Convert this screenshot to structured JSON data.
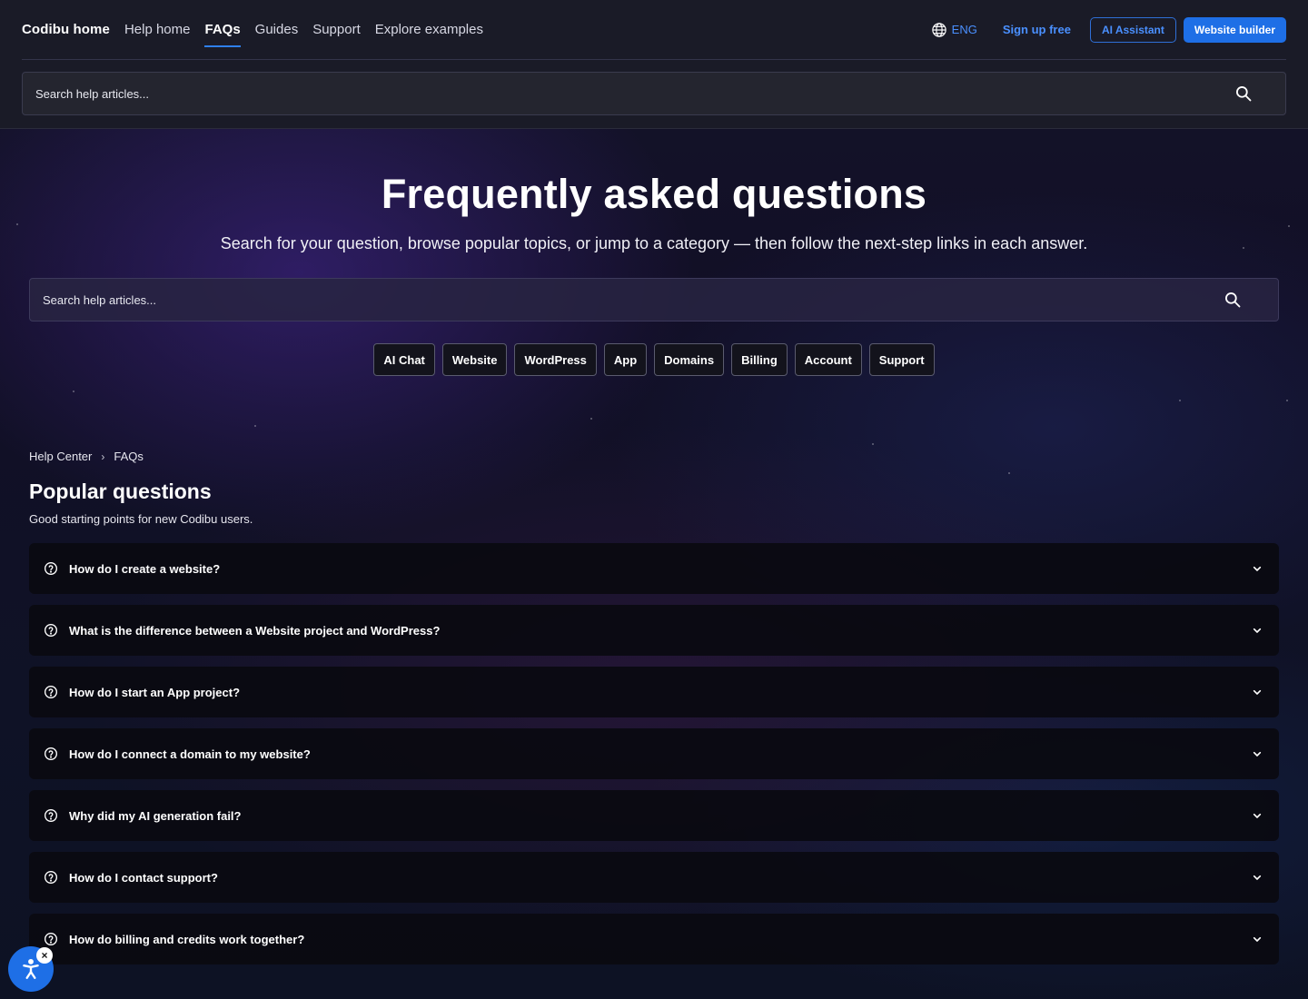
{
  "nav": {
    "brand": "Codibu home",
    "links": [
      "Help home",
      "FAQs",
      "Guides",
      "Support",
      "Explore examples"
    ],
    "active_link": "FAQs",
    "language": "ENG",
    "signup": "Sign up free",
    "ai_assistant": "AI Assistant",
    "website_builder": "Website builder"
  },
  "top_search": {
    "placeholder": "Search help articles..."
  },
  "hero": {
    "title": "Frequently asked questions",
    "subtitle": "Search for your question, browse popular topics, or jump to a category — then follow the next-step links in each answer.",
    "search_placeholder": "Search help articles...",
    "categories": [
      "AI Chat",
      "Website",
      "WordPress",
      "App",
      "Domains",
      "Billing",
      "Account",
      "Support"
    ]
  },
  "breadcrumb": {
    "items": [
      "Help Center",
      "FAQs"
    ],
    "separator": "›"
  },
  "section": {
    "title": "Popular questions",
    "subtitle": "Good starting points for new Codibu users."
  },
  "faqs": [
    "How do I create a website?",
    "What is the difference between a Website project and WordPress?",
    "How do I start an App project?",
    "How do I connect a domain to my website?",
    "Why did my AI generation fail?",
    "How do I contact support?",
    "How do billing and credits work together?"
  ],
  "icons": {
    "language": "globe-icon",
    "search": "search-icon",
    "faq": "question-circle-icon",
    "expand": "chevron-down-icon",
    "accessibility": "accessibility-icon",
    "close": "close-icon"
  },
  "colors": {
    "accent": "#1e6fe6",
    "link": "#4a90ff",
    "header_bg": "#1a1b27"
  },
  "widget": {
    "close_label": "×"
  }
}
